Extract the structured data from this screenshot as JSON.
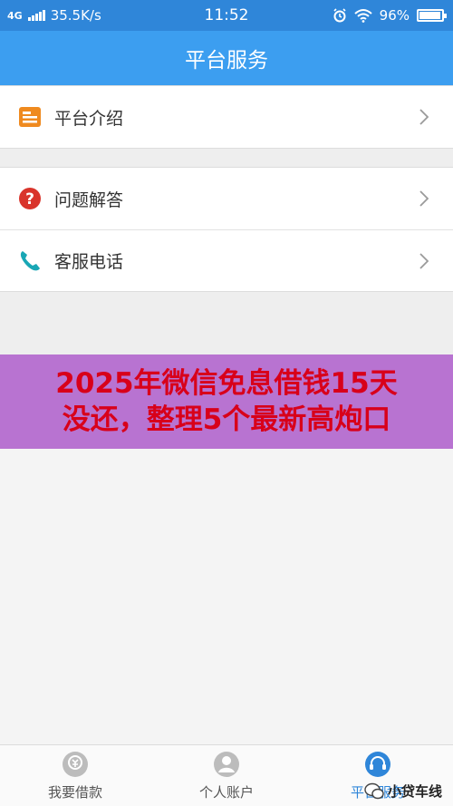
{
  "status_bar": {
    "network": "4G",
    "speed": "35.5K/s",
    "time": "11:52",
    "battery": "96%",
    "battery_level": 0.96
  },
  "navbar": {
    "title": "平台服务"
  },
  "menu": {
    "items": [
      {
        "label": "平台介绍",
        "icon": "document-icon"
      },
      {
        "label": "问题解答",
        "icon": "question-icon"
      },
      {
        "label": "客服电话",
        "icon": "phone-icon"
      }
    ]
  },
  "banner": {
    "line1": "2025年微信免息借钱15天",
    "line2": "没还，整理5个最新高炮口"
  },
  "tabs": [
    {
      "label": "我要借款",
      "icon": "borrow-icon"
    },
    {
      "label": "个人账户",
      "icon": "user-icon"
    },
    {
      "label": "平台服务",
      "icon": "headset-icon"
    }
  ],
  "watermark": {
    "text": "小贷车线"
  },
  "colors": {
    "navbar": "#3c9ef0",
    "statusbar": "#2f86d9",
    "banner_bg": "#b873d1",
    "banner_text": "#d8001a",
    "active_tab": "#2f86d9"
  }
}
